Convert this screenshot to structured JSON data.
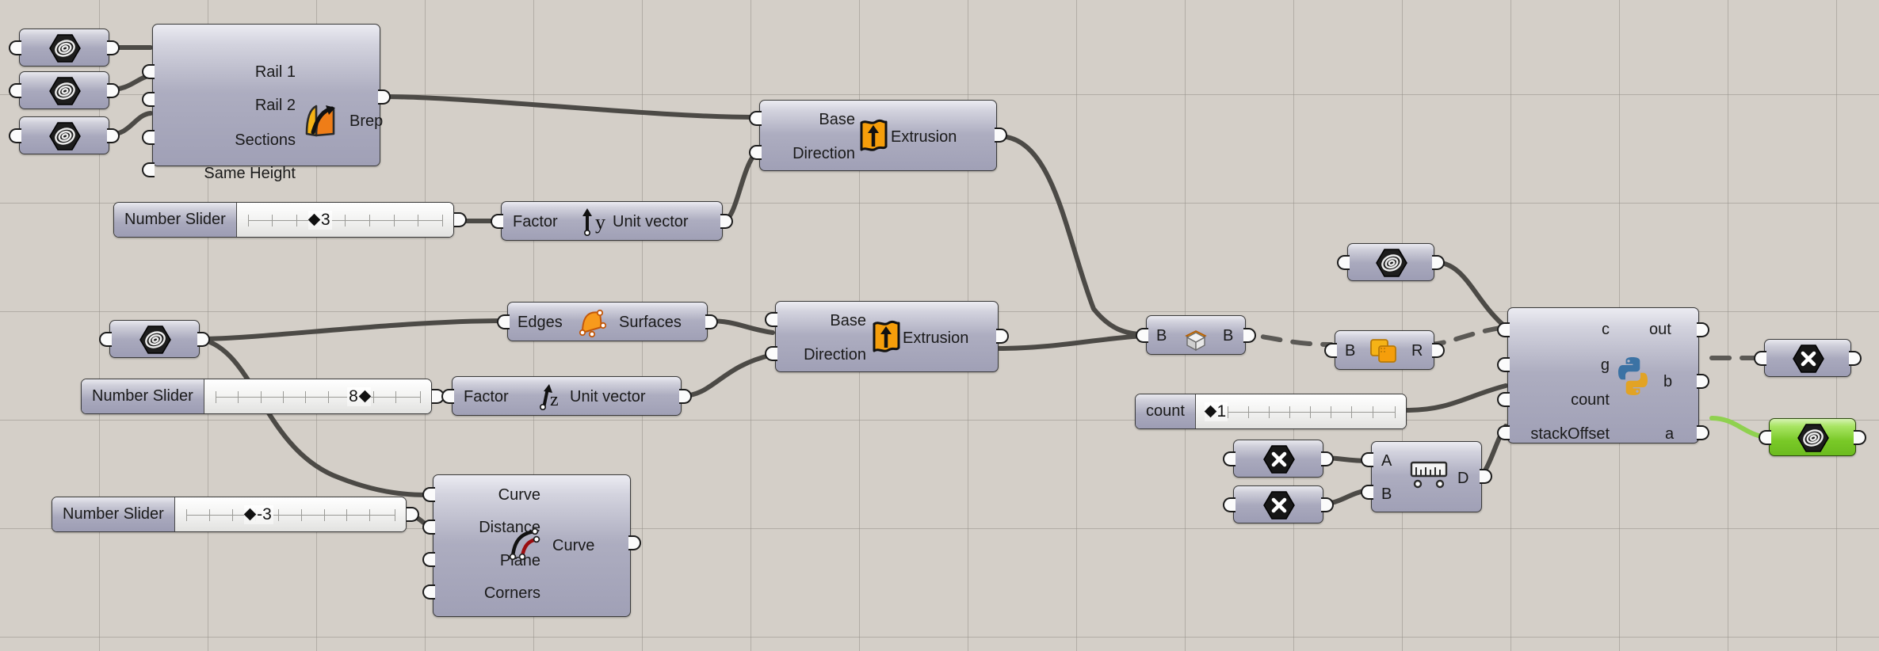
{
  "app": {
    "name": "Grasshopper Canvas",
    "background_color": "#d4cfc8",
    "grid_color": "#96928b",
    "wire_color": "#4c4a46"
  },
  "nodes": {
    "curve_param_1": {
      "name": "Curve",
      "icon": "curve-spiral-icon"
    },
    "curve_param_2": {
      "name": "Curve",
      "icon": "curve-spiral-icon"
    },
    "curve_param_3": {
      "name": "Curve",
      "icon": "curve-spiral-icon"
    },
    "curve_param_4": {
      "name": "Curve",
      "icon": "curve-spiral-icon"
    },
    "curve_param_5": {
      "name": "Curve",
      "icon": "curve-spiral-icon"
    },
    "curve_param_green": {
      "name": "Curve",
      "icon": "curve-spiral-icon",
      "state": "selected",
      "color": "#79c927"
    },
    "sweep2": {
      "title": "Sweep 2 Rails",
      "icon": "sweep2-icon",
      "inputs": [
        "Rail 1",
        "Rail 2",
        "Sections",
        "Same Height"
      ],
      "outputs": [
        "Brep"
      ]
    },
    "extrusion_top": {
      "title": "Extrude",
      "icon": "extrude-icon",
      "inputs": [
        "Base",
        "Direction"
      ],
      "outputs": [
        "Extrusion"
      ]
    },
    "extrusion_mid": {
      "title": "Extrude",
      "icon": "extrude-icon",
      "inputs": [
        "Base",
        "Direction"
      ],
      "outputs": [
        "Extrusion"
      ]
    },
    "unit_y": {
      "title": "Unit Y",
      "icon": "unit-y-icon",
      "inputs": [
        "Factor"
      ],
      "outputs": [
        "Unit vector"
      ]
    },
    "unit_z": {
      "title": "Unit Z",
      "icon": "unit-z-icon",
      "inputs": [
        "Factor"
      ],
      "outputs": [
        "Unit vector"
      ]
    },
    "brep_edges": {
      "title": "Deconstruct Brep",
      "icon": "surfaces-icon",
      "inputs": [
        "Edges"
      ],
      "outputs": [
        "Surfaces"
      ]
    },
    "offset_curve": {
      "title": "Offset Curve",
      "icon": "offset-curve-icon",
      "inputs": [
        "Curve",
        "Distance",
        "Plane",
        "Corners"
      ],
      "outputs": [
        "Curve"
      ]
    },
    "cap_holes": {
      "title": "Cap Holes",
      "icon": "cap-holes-icon",
      "inputs": [
        "B"
      ],
      "outputs": [
        "B"
      ]
    },
    "brep_region": {
      "title": "Brep Region",
      "icon": "region-union-icon",
      "inputs": [
        "B"
      ],
      "outputs": [
        "R"
      ]
    },
    "python": {
      "title": "Python Script",
      "icon": "python-icon",
      "inputs": [
        "c",
        "g",
        "count",
        "stackOffset"
      ],
      "outputs": [
        "out",
        "b",
        "a"
      ]
    },
    "point_param_1": {
      "name": "Point",
      "icon": "point-x-icon"
    },
    "point_param_2": {
      "name": "Point",
      "icon": "point-x-icon"
    },
    "point_param_3": {
      "name": "Point",
      "icon": "point-x-icon"
    },
    "distance": {
      "title": "Distance",
      "icon": "ruler-icon",
      "inputs": [
        "A",
        "B"
      ],
      "outputs": [
        "D"
      ]
    }
  },
  "sliders": [
    {
      "id": "slider_y",
      "label": "Number Slider",
      "value": "3",
      "marker_side": "left",
      "value_pos_pct": 39
    },
    {
      "id": "slider_z",
      "label": "Number Slider",
      "value": "8",
      "marker_side": "right",
      "value_pos_pct": 72
    },
    {
      "id": "slider_d",
      "label": "Number Slider",
      "value": "-3",
      "marker_side": "left",
      "value_pos_pct": 37
    },
    {
      "id": "slider_count",
      "label": "count",
      "value": "1",
      "marker_side": "left",
      "value_pos_pct": 9
    }
  ]
}
